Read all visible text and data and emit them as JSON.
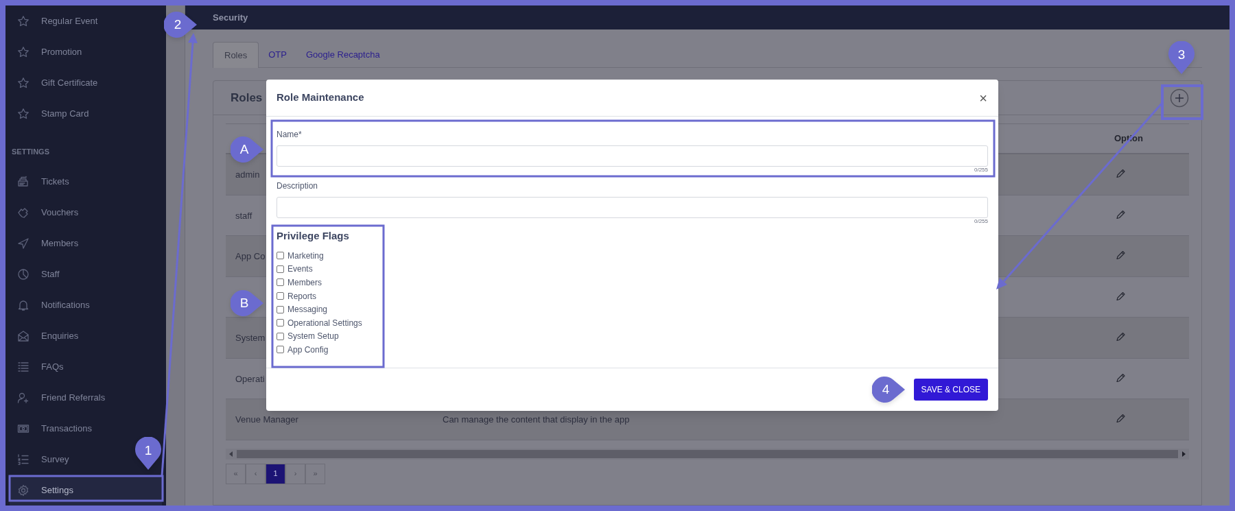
{
  "sidebar": {
    "items": [
      {
        "label": "Regular Event",
        "selected": false
      },
      {
        "label": "Promotion",
        "selected": false
      },
      {
        "label": "Gift Certificate",
        "selected": false
      },
      {
        "label": "Stamp Card",
        "selected": false
      }
    ],
    "section_title": "SETTINGS",
    "settings_items": [
      {
        "label": "Tickets",
        "selected": false
      },
      {
        "label": "Vouchers",
        "selected": false
      },
      {
        "label": "Members",
        "selected": false
      },
      {
        "label": "Staff",
        "selected": false
      },
      {
        "label": "Notifications",
        "selected": false
      },
      {
        "label": "Enquiries",
        "selected": false
      },
      {
        "label": "FAQs",
        "selected": false
      },
      {
        "label": "Friend Referrals",
        "selected": false
      },
      {
        "label": "Transactions",
        "selected": false
      },
      {
        "label": "Survey",
        "selected": false
      },
      {
        "label": "Settings",
        "selected": true
      }
    ]
  },
  "header": {
    "title": "Security"
  },
  "tabs": [
    {
      "label": "Roles",
      "selected": true
    },
    {
      "label": "OTP",
      "selected": false
    },
    {
      "label": "Google Recaptcha",
      "selected": false
    }
  ],
  "roles_card": {
    "title": "Roles",
    "table": {
      "columns": [
        "Option"
      ],
      "rows": [
        {
          "name": "admin"
        },
        {
          "name": "staff"
        },
        {
          "name": "App Co"
        },
        {},
        {
          "name": "System"
        },
        {
          "name": "Operati"
        },
        {
          "name": "Venue Manager",
          "description": "Can manage the content that display in the app"
        }
      ]
    },
    "pagination": {
      "first": "«",
      "prev": "‹",
      "pages": [
        {
          "label": "1",
          "selected": true
        }
      ],
      "next": "›",
      "last": "»"
    }
  },
  "modal": {
    "title": "Role Maintenance",
    "close": "×",
    "fields": [
      {
        "label": "Name*",
        "counter": "0/255"
      },
      {
        "label": "Description",
        "counter": "0/255"
      }
    ],
    "flags_title": "Privilege Flags",
    "flags": [
      {
        "label": "Marketing",
        "checked": false
      },
      {
        "label": "Events",
        "checked": false
      },
      {
        "label": "Members",
        "checked": false
      },
      {
        "label": "Reports",
        "checked": false
      },
      {
        "label": "Messaging",
        "checked": false
      },
      {
        "label": "Operational Settings",
        "checked": false
      },
      {
        "label": "System Setup",
        "checked": false
      },
      {
        "label": "App Config",
        "checked": false
      }
    ],
    "save_button": "SAVE & CLOSE"
  },
  "callouts": [
    {
      "label": "1",
      "kind": "down"
    },
    {
      "label": "2",
      "kind": "right"
    },
    {
      "label": "3",
      "kind": "down"
    },
    {
      "label": "4",
      "kind": "right"
    },
    {
      "label": "A",
      "kind": "right"
    },
    {
      "label": "B",
      "kind": "right"
    }
  ]
}
